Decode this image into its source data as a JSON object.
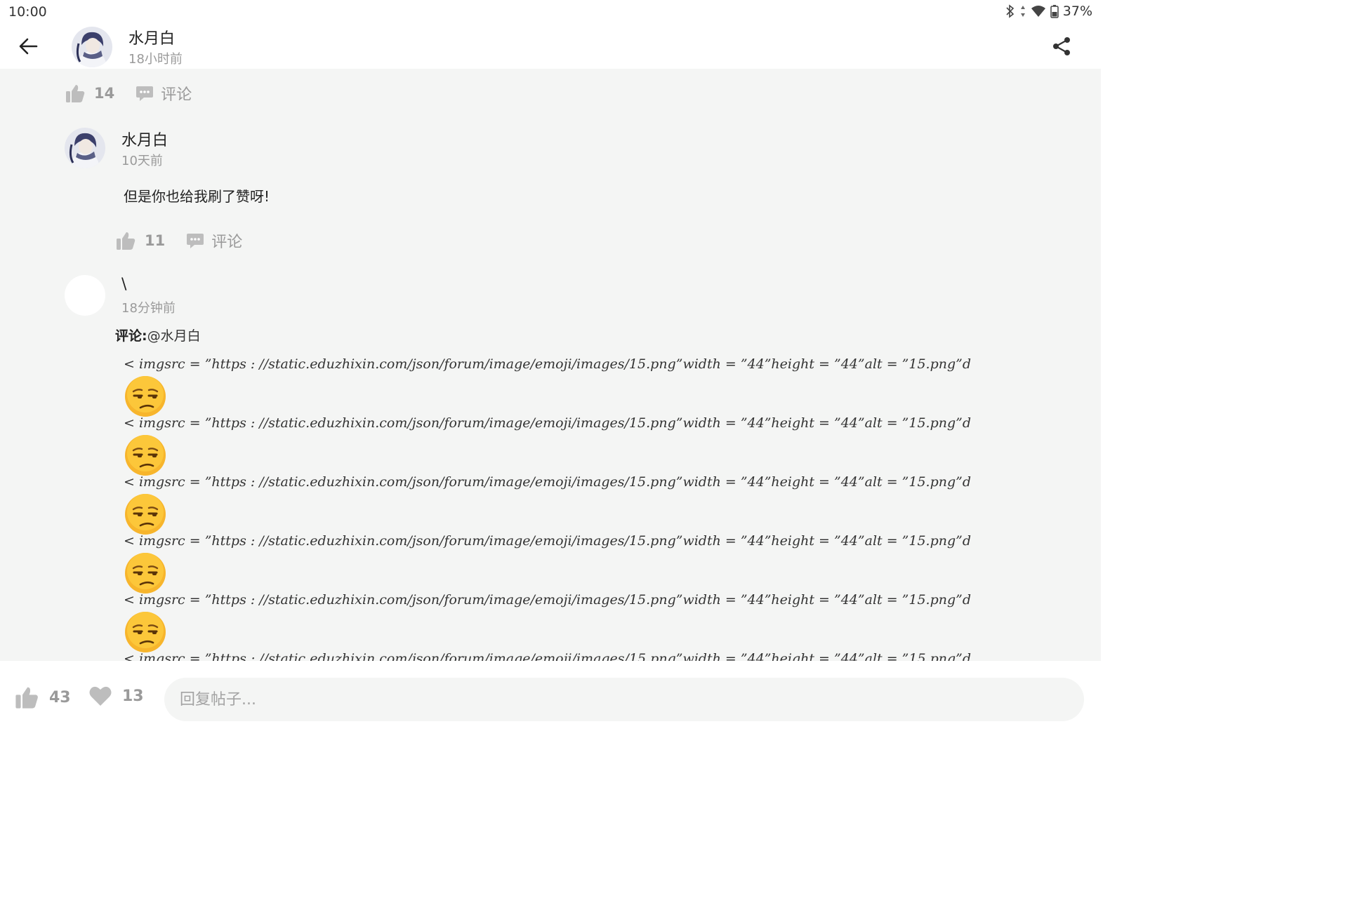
{
  "status": {
    "time": "10:00",
    "battery": "37%"
  },
  "header": {
    "author": "水月白",
    "time": "18小时前"
  },
  "post_actions": {
    "likes": "14",
    "comment_label": "评论"
  },
  "comment1": {
    "author": "水月白",
    "time": "10天前",
    "text": "但是你也给我刷了赞呀!",
    "likes": "11",
    "comment_label": "评论"
  },
  "reply": {
    "author": "\\",
    "time": "18分钟前",
    "reply_label": "评论:",
    "reply_target": "@水月白",
    "raw_line": "< imgsrc = ”https : //static.eduzhixin.com/json/forum/image/emoji/images/15.png”width = ”44”height = ”44”alt = ”15.png”d"
  },
  "bottom": {
    "likes": "43",
    "favorites": "13",
    "reply_placeholder": "回复帖子..."
  },
  "colors": {
    "background": "#f4f5f4",
    "icon_grey": "#bdbdbd",
    "text_grey": "#9a9a9a"
  }
}
